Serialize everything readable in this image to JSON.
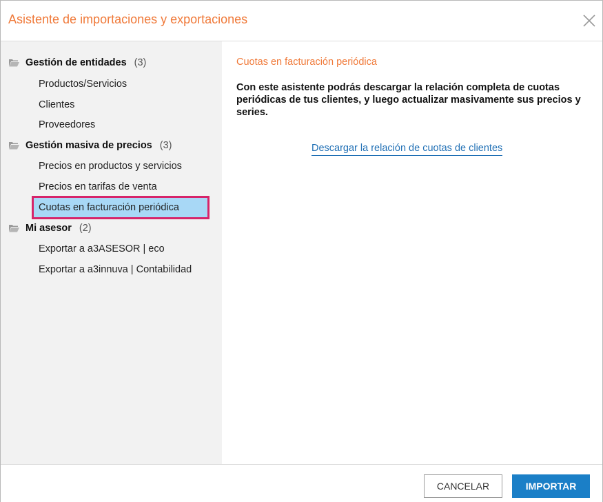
{
  "dialog": {
    "title": "Asistente de importaciones y exportaciones"
  },
  "sidebar": {
    "groups": [
      {
        "name": "Gestión de entidades",
        "count": "(3)",
        "items": [
          "Productos/Servicios",
          "Clientes",
          "Proveedores"
        ]
      },
      {
        "name": "Gestión masiva de precios",
        "count": "(3)",
        "items": [
          "Precios en productos y servicios",
          "Precios en tarifas de venta",
          "Cuotas en facturación periódica"
        ]
      },
      {
        "name": "Mi asesor",
        "count": "(2)",
        "items": [
          "Exportar a a3ASESOR | eco",
          "Exportar a a3innuva | Contabilidad"
        ]
      }
    ],
    "selected_item": "Cuotas en facturación periódica"
  },
  "content": {
    "title": "Cuotas en facturación periódica",
    "description": "Con este asistente podrás descargar la relación completa de cuotas periódicas de tus clientes, y luego actualizar masivamente sus precios y series.",
    "link": "Descargar la relación de cuotas de clientes"
  },
  "footer": {
    "cancel_label": "CANCELAR",
    "import_label": "IMPORTAR"
  },
  "icons": {
    "close": "close-icon",
    "folder": "folder-icon"
  },
  "colors": {
    "accent_orange": "#f07a3a",
    "primary_blue": "#1b7fc7",
    "link_blue": "#1f6fb5",
    "selected_bg": "#a8d8f6",
    "highlight_border": "#d6246a",
    "sidebar_bg": "#f2f2f2"
  }
}
